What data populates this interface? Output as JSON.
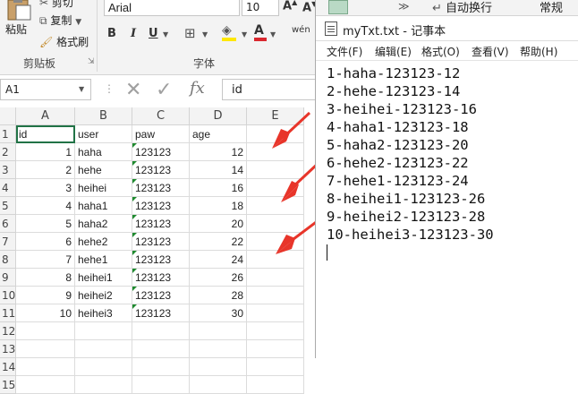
{
  "ribbon": {
    "paste_label": "粘贴",
    "cut_label": "剪切",
    "copy_label": "复制",
    "format_painter_label": "格式刷",
    "clipboard_group": "剪贴板",
    "font_name": "Arial",
    "font_size": "10",
    "bold": "B",
    "italic": "I",
    "underline": "U",
    "font_group": "字体",
    "wrap_text_label": "自动换行",
    "number_format": "常规",
    "phonetic": "wén"
  },
  "formula_bar": {
    "name_box": "A1",
    "fx": "fx",
    "content": "id"
  },
  "sheet": {
    "columns": [
      "A",
      "B",
      "C",
      "D",
      "E"
    ],
    "rows": [
      "1",
      "2",
      "3",
      "4",
      "5",
      "6",
      "7",
      "8",
      "9",
      "10",
      "11",
      "12",
      "13",
      "14",
      "15"
    ],
    "headers": [
      "id",
      "user",
      "paw",
      "age"
    ],
    "data": [
      [
        "1",
        "haha",
        "123123",
        "12"
      ],
      [
        "2",
        "hehe",
        "123123",
        "14"
      ],
      [
        "3",
        "heihei",
        "123123",
        "16"
      ],
      [
        "4",
        "haha1",
        "123123",
        "18"
      ],
      [
        "5",
        "haha2",
        "123123",
        "20"
      ],
      [
        "6",
        "hehe2",
        "123123",
        "22"
      ],
      [
        "7",
        "hehe1",
        "123123",
        "24"
      ],
      [
        "8",
        "heihei1",
        "123123",
        "26"
      ],
      [
        "9",
        "heihei2",
        "123123",
        "28"
      ],
      [
        "10",
        "heihei3",
        "123123",
        "30"
      ]
    ]
  },
  "notepad": {
    "title": "myTxt.txt - 记事本",
    "menus": [
      "文件(F)",
      "编辑(E)",
      "格式(O)",
      "查看(V)",
      "帮助(H)"
    ],
    "lines": [
      "1-haha-123123-12",
      "2-hehe-123123-14",
      "3-heihei-123123-16",
      "4-haha1-123123-18",
      "5-haha2-123123-20",
      "6-hehe2-123123-22",
      "7-hehe1-123123-24",
      "8-heihei1-123123-26",
      "9-heihei2-123123-28",
      "10-heihei3-123123-30"
    ]
  },
  "colors": {
    "ribbon_bg": "#f3f3f3",
    "arrow": "#e8352a",
    "error_triangle": "#1e8a2e",
    "font_color_red": "#d9272e",
    "highlight_yellow": "#ffe800"
  }
}
